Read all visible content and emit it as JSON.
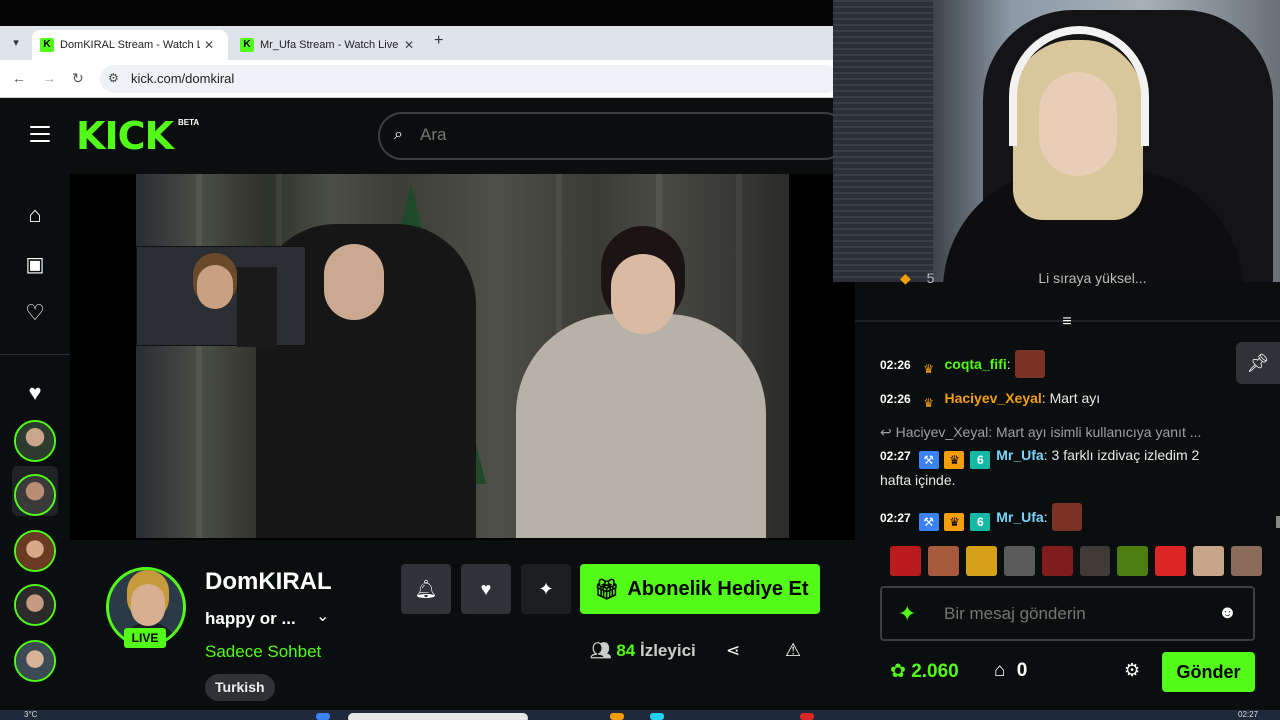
{
  "browser": {
    "tabs": [
      {
        "title": "DomKIRAL Stream - Watch Live",
        "favicon": "K",
        "active": true
      },
      {
        "title": "Mr_Ufa Stream - Watch Live on",
        "favicon": "K",
        "active": false
      }
    ],
    "url": "kick.com/domkiral"
  },
  "header": {
    "logo": "KICK",
    "beta": "BETA",
    "search_placeholder": "Ara"
  },
  "channel": {
    "name": "DomKIRAL",
    "title": "happy or ...",
    "category": "Sadece Sohbet",
    "tag": "Turkish",
    "live_label": "LIVE",
    "gift_label": "Abonelik Hediye Et",
    "viewer_count": "84",
    "viewer_label": "İzleyici"
  },
  "chat": {
    "pinned_count": "5",
    "pinned_text": "Li sıraya yüksel...",
    "messages": [
      {
        "time": "02:26",
        "user": "coqta_fifi",
        "color": "#53fc18",
        "text": ""
      },
      {
        "time": "02:26",
        "user": "Haciyev_Xeyal",
        "color": "#f59e0b",
        "text": "Mart ayı"
      },
      {
        "time": "02:27",
        "user": "Mr_Ufa",
        "color": "#7dd3fc",
        "text": "3 farklı izdivaç izledim 2 hafta içinde."
      },
      {
        "time": "02:27",
        "user": "Mr_Ufa",
        "color": "#7dd3fc",
        "text": ""
      }
    ],
    "reply_text": "Haciyev_Xeyal: Mart ayı isimli kullanıcıya yanıt ...",
    "input_placeholder": "Bir mesaj gönderin",
    "points": "2.060",
    "store_count": "0",
    "send_label": "Gönder"
  },
  "taskbar": {
    "temperature": "3°C",
    "time": "02:27"
  },
  "colors": {
    "accent": "#53fc18",
    "background": "#0b0e0f"
  }
}
